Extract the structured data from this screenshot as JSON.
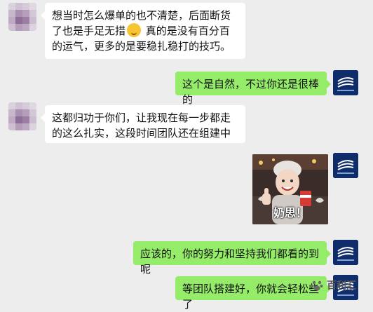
{
  "chat": {
    "messages": [
      {
        "side": "left",
        "text_before": "想当时怎么爆单的也不清楚，后面断货了也是手足无措",
        "emoji": "laughing-emoji",
        "text_after": " 真的是没有百分百的运气，更多的是要稳扎稳打的技巧。"
      },
      {
        "side": "right",
        "text": "这个是自然，不过你还是很棒的"
      },
      {
        "side": "left",
        "text": "这都归功于你们，让我现在每一步都走的这么扎实，这段时间团队还在组建中"
      },
      {
        "side": "right",
        "sticker_caption": "奶思！"
      },
      {
        "side": "right",
        "text": "应该的，你的努力和坚持我们都看的到呢"
      },
      {
        "side": "right",
        "text": "等团队搭建好，你就会轻松些了"
      }
    ]
  },
  "watermark": {
    "label": "百利汇",
    "icon": "wechat-paw-icon"
  },
  "colors": {
    "background": "#ededed",
    "bubble_left": "#ffffff",
    "bubble_right": "#95ec69",
    "avatar_right_bg": "#0f2c6b"
  }
}
